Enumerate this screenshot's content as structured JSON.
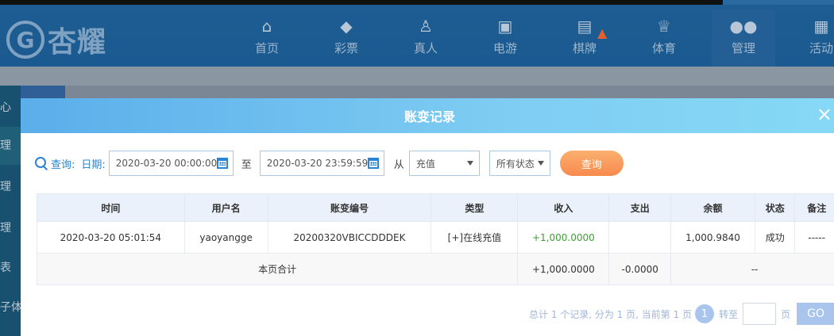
{
  "header": {
    "logo_text": "杏耀",
    "nav": [
      {
        "label": "首页",
        "icon": "home-icon"
      },
      {
        "label": "彩票",
        "icon": "lottery-ticket-icon"
      },
      {
        "label": "真人",
        "icon": "live-dealer-icon"
      },
      {
        "label": "电游",
        "icon": "slot-machine-icon"
      },
      {
        "label": "棋牌",
        "icon": "card-game-icon"
      },
      {
        "label": "体育",
        "icon": "trophy-icon"
      },
      {
        "label": "管理",
        "icon": "users-icon"
      },
      {
        "label": "活动",
        "icon": "gift-icon"
      }
    ]
  },
  "sidebar": {
    "items": [
      "心",
      "理",
      "理",
      "理",
      "表",
      "子体"
    ]
  },
  "modal": {
    "title": "账变记录",
    "close": "×"
  },
  "query": {
    "label": "查询:",
    "date_label": "日期:",
    "start_date": "2020-03-20 00:00:00",
    "to_label": "至",
    "end_date": "2020-03-20 23:59:59",
    "from_label": "从",
    "type_select": "充值",
    "status_select": "所有状态",
    "submit": "查询"
  },
  "table": {
    "columns": [
      "时间",
      "用户名",
      "账变编号",
      "类型",
      "收入",
      "支出",
      "余额",
      "状态",
      "备注"
    ],
    "rows": [
      {
        "time": "2020-03-20 05:01:54",
        "username": "yaoyangge",
        "id": "20200320VBICCDDDEK",
        "type": "[+]在线充值",
        "income": "+1,000.0000",
        "expense": "",
        "balance": "1,000.9840",
        "status": "成功",
        "note": "-----"
      }
    ],
    "total": {
      "label": "本页合计",
      "income": "+1,000.0000",
      "expense": "-0.0000",
      "rest": "--"
    }
  },
  "pagination": {
    "summary": "总计 1 个记录, 分为 1 页, 当前第 1 页",
    "current_page": "1",
    "jump_label": "转至",
    "page_unit": "页",
    "go": "GO"
  },
  "colors": {
    "nav_bg": "#1d5d92",
    "header_gradient_start": "#5aaeea",
    "header_gradient_end": "#86d9f6",
    "accent_blue": "#2a84d6",
    "query_button": "#f88a4e",
    "income_green": "#3e9e33"
  }
}
